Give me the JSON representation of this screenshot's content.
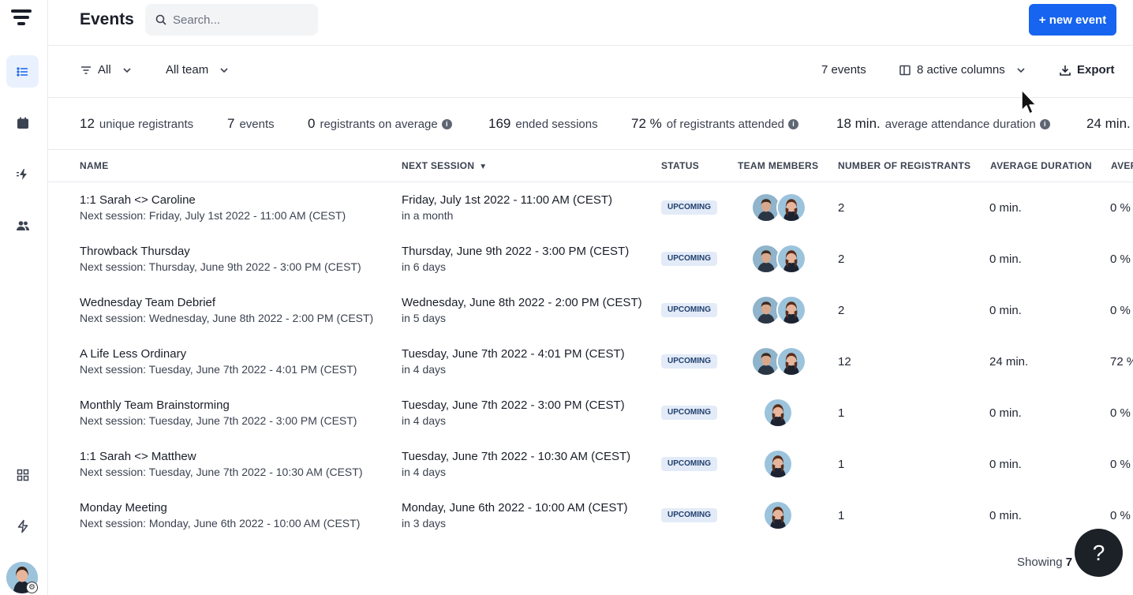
{
  "header": {
    "title": "Events",
    "search_placeholder": "Search...",
    "new_event_label": "+ new event"
  },
  "filters": {
    "type_label": "All",
    "team_label": "All team",
    "events_count_label": "7 events",
    "columns_label": "8 active columns",
    "export_label": "Export"
  },
  "stats": [
    {
      "value": "12",
      "label": "unique registrants"
    },
    {
      "value": "7",
      "label": "events"
    },
    {
      "value": "0",
      "label": "registrants on average"
    },
    {
      "value": "169",
      "label": "ended sessions"
    },
    {
      "value": "72 %",
      "label": "of registrants attended"
    },
    {
      "value": "18 min.",
      "label": "average attendance duration"
    },
    {
      "value": "24 min.",
      "label": ""
    }
  ],
  "table": {
    "columns": [
      "NAME",
      "NEXT SESSION",
      "STATUS",
      "TEAM MEMBERS",
      "NUMBER OF REGISTRANTS",
      "AVERAGE DURATION",
      "AVEF"
    ],
    "rows": [
      {
        "name": "1:1 Sarah <> Caroline",
        "sub": "Next session: Friday, July 1st 2022 - 11:00 AM (CEST)",
        "next": "Friday, July 1st 2022 - 11:00 AM (CEST)",
        "relative": "in a month",
        "status": "UPCOMING",
        "members": 2,
        "registrants": "2",
        "duration": "0 min.",
        "attendance": "0 %"
      },
      {
        "name": "Throwback Thursday",
        "sub": "Next session: Thursday, June 9th 2022 - 3:00 PM (CEST)",
        "next": "Thursday, June 9th 2022 - 3:00 PM (CEST)",
        "relative": "in 6 days",
        "status": "UPCOMING",
        "members": 2,
        "registrants": "2",
        "duration": "0 min.",
        "attendance": "0 %"
      },
      {
        "name": "Wednesday Team Debrief",
        "sub": "Next session: Wednesday, June 8th 2022 - 2:00 PM (CEST)",
        "next": "Wednesday, June 8th 2022 - 2:00 PM (CEST)",
        "relative": "in 5 days",
        "status": "UPCOMING",
        "members": 2,
        "registrants": "2",
        "duration": "0 min.",
        "attendance": "0 %"
      },
      {
        "name": "A Life Less Ordinary",
        "sub": "Next session: Tuesday, June 7th 2022 - 4:01 PM (CEST)",
        "next": "Tuesday, June 7th 2022 - 4:01 PM (CEST)",
        "relative": "in 4 days",
        "status": "UPCOMING",
        "members": 2,
        "registrants": "12",
        "duration": "24 min.",
        "attendance": "72 %"
      },
      {
        "name": "Monthly Team Brainstorming",
        "sub": "Next session: Tuesday, June 7th 2022 - 3:00 PM (CEST)",
        "next": "Tuesday, June 7th 2022 - 3:00 PM (CEST)",
        "relative": "in 4 days",
        "status": "UPCOMING",
        "members": 1,
        "registrants": "1",
        "duration": "0 min.",
        "attendance": "0 %"
      },
      {
        "name": "1:1 Sarah <> Matthew",
        "sub": "Next session: Tuesday, June 7th 2022 - 10:30 AM (CEST)",
        "next": "Tuesday, June 7th 2022 - 10:30 AM (CEST)",
        "relative": "in 4 days",
        "status": "UPCOMING",
        "members": 1,
        "registrants": "1",
        "duration": "0 min.",
        "attendance": "0 %"
      },
      {
        "name": "Monday Meeting",
        "sub": "Next session: Monday, June 6th 2022 - 10:00 AM (CEST)",
        "next": "Monday, June 6th 2022 - 10:00 AM (CEST)",
        "relative": "in 3 days",
        "status": "UPCOMING",
        "members": 1,
        "registrants": "1",
        "duration": "0 min.",
        "attendance": "0 %"
      }
    ]
  },
  "footer": {
    "showing_label": "Showing",
    "showing_count": "7",
    "help_label": "?"
  },
  "colors": {
    "accent": "#1664ef",
    "badge_bg": "#e3ebf8",
    "badge_text": "#22406e"
  }
}
